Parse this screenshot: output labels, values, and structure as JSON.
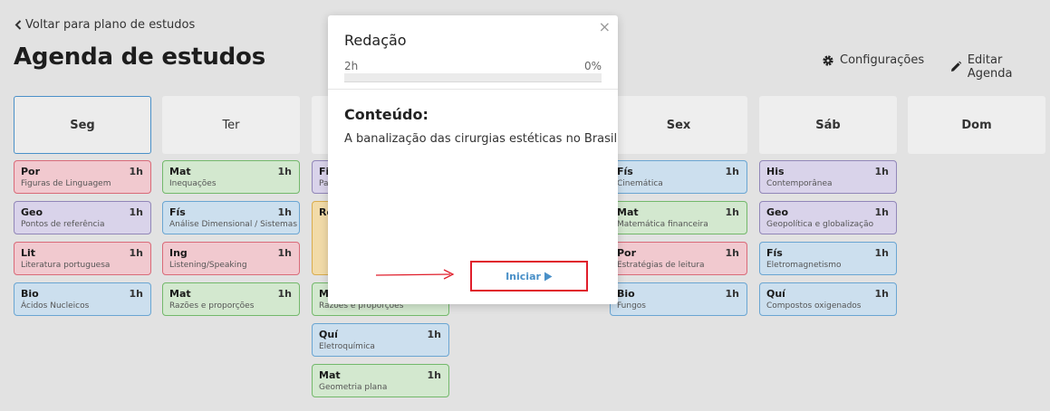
{
  "header": {
    "back_label": "Voltar para plano de estudos",
    "title": "Agenda de estudos",
    "config_label": "Configurações",
    "edit_label": "Editar Agenda"
  },
  "days": [
    {
      "label": "Seg",
      "cards": [
        {
          "subject": "Por",
          "duration": "1h",
          "topic": "Figuras de Linguagem",
          "color": "red"
        },
        {
          "subject": "Geo",
          "duration": "1h",
          "topic": "Pontos de referência",
          "color": "purple"
        },
        {
          "subject": "Lit",
          "duration": "1h",
          "topic": "Literatura portuguesa",
          "color": "red"
        },
        {
          "subject": "Bio",
          "duration": "1h",
          "topic": "Ácidos Nucleicos",
          "color": "blue"
        }
      ]
    },
    {
      "label": "Ter",
      "cards": [
        {
          "subject": "Mat",
          "duration": "1h",
          "topic": "Inequações",
          "color": "green"
        },
        {
          "subject": "Fís",
          "duration": "1h",
          "topic": "Análise Dimensional / Sistemas",
          "color": "blue"
        },
        {
          "subject": "Ing",
          "duration": "1h",
          "topic": "Listening/Speaking",
          "color": "red"
        },
        {
          "subject": "Mat",
          "duration": "1h",
          "topic": "Razões e proporções",
          "color": "green"
        }
      ]
    },
    {
      "label": "",
      "cards": [
        {
          "subject": "Fil",
          "duration": "",
          "topic": "Pa",
          "color": "purple"
        },
        {
          "subject": "Re",
          "duration": "",
          "topic": "",
          "color": "orange"
        },
        {
          "subject": "Ma",
          "duration": "",
          "topic": "Razões e proporções",
          "color": "green"
        },
        {
          "subject": "Quí",
          "duration": "1h",
          "topic": "Eletroquímica",
          "color": "blue"
        },
        {
          "subject": "Mat",
          "duration": "1h",
          "topic": "Geometria plana",
          "color": "green"
        }
      ]
    },
    {
      "label": "Sex",
      "cards": [
        {
          "subject": "Fís",
          "duration": "1h",
          "topic": "Cinemática",
          "color": "blue"
        },
        {
          "subject": "Mat",
          "duration": "1h",
          "topic": "Matemática financeira",
          "color": "green"
        },
        {
          "subject": "Por",
          "duration": "1h",
          "topic": "Estratégias de leitura",
          "color": "red"
        },
        {
          "subject": "Bio",
          "duration": "1h",
          "topic": "Fungos",
          "color": "blue"
        }
      ]
    },
    {
      "label": "Sáb",
      "cards": [
        {
          "subject": "His",
          "duration": "1h",
          "topic": "Contemporânea",
          "color": "purple"
        },
        {
          "subject": "Geo",
          "duration": "1h",
          "topic": "Geopolítica e globalização",
          "color": "purple"
        },
        {
          "subject": "Fís",
          "duration": "1h",
          "topic": "Eletromagnetismo",
          "color": "blue"
        },
        {
          "subject": "Quí",
          "duration": "1h",
          "topic": "Compostos oxigenados",
          "color": "blue"
        }
      ]
    },
    {
      "label": "Dom",
      "cards": []
    }
  ],
  "modal": {
    "close_symbol": "×",
    "title": "Redação",
    "duration": "2h",
    "progress_label": "0%",
    "progress_fraction": 0,
    "content_heading": "Conteúdo:",
    "content_text": "A banalização das cirurgias estéticas no Brasil",
    "start_label": "Iniciar"
  },
  "colors": {
    "accent": "#4a90c8",
    "highlight": "#e01e2b"
  }
}
